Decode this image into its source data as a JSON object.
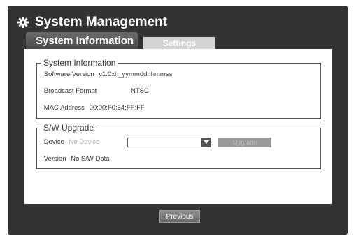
{
  "window": {
    "title": "System Management",
    "icon": "gear-icon"
  },
  "tabs": [
    {
      "label": "System Information",
      "active": true
    },
    {
      "label": "Settings",
      "active": false
    }
  ],
  "system_info": {
    "legend": "System Information",
    "software_version_label": "· Software Version",
    "software_version_value": "v1.0xh_yymmddhhmmss",
    "broadcast_format_label": "· Broadcast Format",
    "broadcast_format_value": "NTSC",
    "mac_address_label": "· MAC Address",
    "mac_address_value": "00:00:F0:54:FF:FF"
  },
  "sw_upgrade": {
    "legend": "S/W Upgrade",
    "device_label": "· Device",
    "device_value": "No Device",
    "device_select_value": "",
    "upgrade_button_label": "Upgrade",
    "version_label": "· Version",
    "version_value": "No S/W Data"
  },
  "footer": {
    "previous_label": "Previous"
  },
  "colors": {
    "frame": "#333333",
    "active_tab": "#5a5a5a",
    "inactive_tab": "#d4d4d4"
  }
}
